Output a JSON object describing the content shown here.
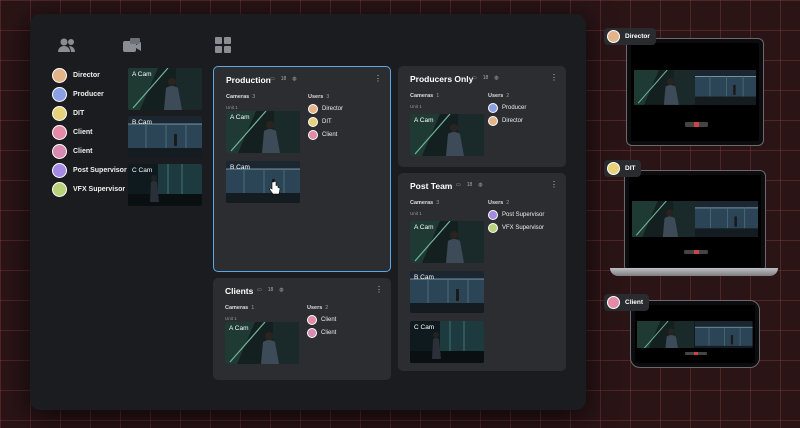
{
  "top_icons": [
    "users-icon",
    "cameras-icon",
    "grid-icon"
  ],
  "roster": [
    {
      "name": "Director",
      "color": "#e3b38a"
    },
    {
      "name": "Producer",
      "color": "#8aa0e3"
    },
    {
      "name": "DIT",
      "color": "#e6d27a"
    },
    {
      "name": "Client",
      "color": "#e38aa6"
    },
    {
      "name": "Client",
      "color": "#d98ab0"
    },
    {
      "name": "Post Supervisor",
      "color": "#a58ae3"
    },
    {
      "name": "VFX Supervisor",
      "color": "#b8d27a"
    }
  ],
  "cameras": [
    {
      "label": "A Cam"
    },
    {
      "label": "B Cam"
    },
    {
      "label": "C Cam"
    }
  ],
  "groups": {
    "production": {
      "title": "Production",
      "cameras_label": "Cameras",
      "cameras_count": "3",
      "users_label": "Users",
      "users_count": "3",
      "unit": "Unit 1",
      "count": "18",
      "thumbs": [
        "A Cam",
        "B Cam"
      ],
      "users": [
        {
          "name": "Director",
          "color": "#e3b38a"
        },
        {
          "name": "DIT",
          "color": "#e6d27a"
        },
        {
          "name": "Client",
          "color": "#e38aa6"
        }
      ]
    },
    "producers": {
      "title": "Producers Only",
      "cameras_label": "Cameras",
      "cameras_count": "1",
      "users_label": "Users",
      "users_count": "2",
      "unit": "Unit 1",
      "count": "18",
      "thumbs": [
        "A Cam"
      ],
      "users": [
        {
          "name": "Producer",
          "color": "#8aa0e3"
        },
        {
          "name": "Director",
          "color": "#e3b38a"
        }
      ]
    },
    "clients": {
      "title": "Clients",
      "cameras_label": "Cameras",
      "cameras_count": "1",
      "users_label": "Users",
      "users_count": "2",
      "unit": "Unit 1",
      "count": "18",
      "thumbs": [
        "A Cam"
      ],
      "users": [
        {
          "name": "Client",
          "color": "#e38aa6"
        },
        {
          "name": "Client",
          "color": "#d98ab0"
        }
      ]
    },
    "post": {
      "title": "Post Team",
      "cameras_label": "Cameras",
      "cameras_count": "3",
      "users_label": "Users",
      "users_count": "2",
      "unit": "Unit 1",
      "count": "18",
      "thumbs": [
        "A Cam",
        "B Cam",
        "C Cam"
      ],
      "users": [
        {
          "name": "Post Supervisor",
          "color": "#a58ae3"
        },
        {
          "name": "VFX Supervisor",
          "color": "#b8d27a"
        }
      ]
    }
  },
  "devices": [
    {
      "name": "Director",
      "type": "tablet",
      "color": "#e3b38a"
    },
    {
      "name": "DIT",
      "type": "laptop",
      "color": "#e6d27a"
    },
    {
      "name": "Client",
      "type": "phone",
      "color": "#e38aa6"
    }
  ],
  "colors": {
    "accent": "#5aa8e6",
    "board": "#1a1c1f",
    "card": "#2b2d31"
  }
}
